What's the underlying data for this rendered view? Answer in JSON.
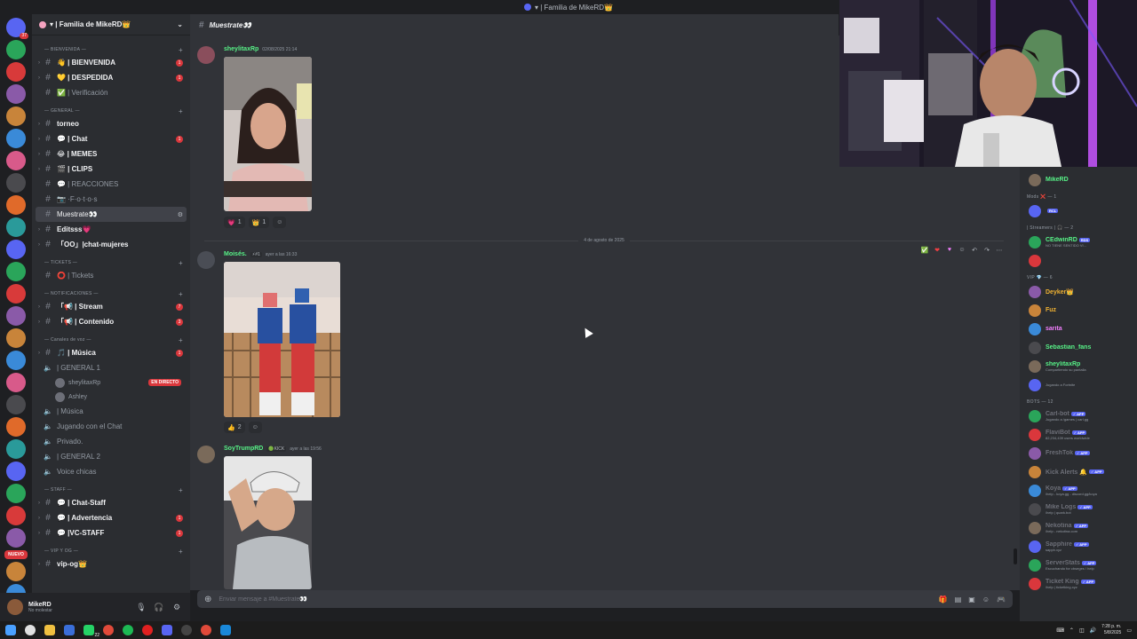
{
  "window": {
    "title": "▾ | Familia de MikeRD👑"
  },
  "server": {
    "name": "▾ | Familia de MikeRD👑"
  },
  "rail": {
    "badges": [
      "37",
      "",
      "",
      "",
      "",
      "",
      "",
      "",
      "",
      "",
      "",
      "",
      "",
      "",
      "",
      "",
      "",
      "",
      "",
      "",
      "",
      "",
      "",
      "",
      "",
      "",
      "",
      ""
    ],
    "nuevo": "NUEVO"
  },
  "categories": {
    "bienvenida": "BIENVENIDA",
    "general": "GENERAL",
    "tickets": "TICKETS",
    "notificaciones": "NOTIFICACIONES",
    "voz": "Canales de voz",
    "staff": "STAFF",
    "vip": "VIP Y OG"
  },
  "channels": [
    {
      "label": "👋 | BIENVENIDA",
      "bold": true,
      "count": "1"
    },
    {
      "label": "💛 | DESPEDIDA",
      "bold": true,
      "count": "1"
    },
    {
      "label": "✅ | Verificación",
      "bold": false,
      "count": ""
    },
    {
      "label": "torneo",
      "bold": true,
      "count": ""
    },
    {
      "label": "💬 | Chat",
      "bold": true,
      "count": "1"
    },
    {
      "label": "😂 | MEMES",
      "bold": true,
      "count": ""
    },
    {
      "label": "🎬 | CLIPS",
      "bold": true,
      "count": ""
    },
    {
      "label": "💬 | REACCIONES",
      "bold": false,
      "count": ""
    },
    {
      "label": "📷 ·F·o·t·o·s",
      "bold": false,
      "count": ""
    },
    {
      "label": "Muestrate👀",
      "bold": false,
      "count": "",
      "active": true
    },
    {
      "label": "Editsss💗",
      "bold": true,
      "count": ""
    },
    {
      "label": "「OO」|chat-mujeres",
      "bold": true,
      "count": ""
    },
    {
      "label": "⭕ | Tickets",
      "bold": false,
      "count": ""
    },
    {
      "label": "「📢 | Stream",
      "bold": true,
      "count": "7"
    },
    {
      "label": "「📢 | Contenido",
      "bold": true,
      "count": "3"
    },
    {
      "label": "🎵 | Música",
      "bold": true,
      "count": "1"
    },
    {
      "label": "| GENERAL 1",
      "bold": false,
      "count": ""
    },
    {
      "label": "| Música",
      "bold": false,
      "count": ""
    },
    {
      "label": "Jugando con el Chat",
      "bold": false,
      "count": ""
    },
    {
      "label": "Privado.",
      "bold": false,
      "count": ""
    },
    {
      "label": "| GENERAL 2",
      "bold": false,
      "count": ""
    },
    {
      "label": "Voice chicas",
      "bold": false,
      "count": ""
    },
    {
      "label": "💬 | Chat-Staff",
      "bold": true,
      "count": ""
    },
    {
      "label": "💬 | Advertencia",
      "bold": true,
      "count": "1"
    },
    {
      "label": "💬 |VC-STAFF",
      "bold": true,
      "count": "1"
    },
    {
      "label": "vip-og👑",
      "bold": true,
      "count": ""
    }
  ],
  "voice_users": [
    {
      "name": "sheylitaxRp",
      "live": "EN DIRECTO"
    },
    {
      "name": "Ashley",
      "live": ""
    }
  ],
  "user_panel": {
    "name": "MikeRD",
    "status": "No molestar"
  },
  "chat": {
    "channel": "Muestrate👀",
    "date_divider": "4 de agosto de 2025",
    "composer_placeholder": "Enviar mensaje a #Muestrate👀",
    "messages": [
      {
        "user": "sheylitaxRp",
        "color": "#57f287",
        "time": "02/08/2025 21:14",
        "tag": "",
        "reactions": [
          {
            "emoji": "💗",
            "count": "1"
          },
          {
            "emoji": "👑",
            "count": "1"
          }
        ]
      },
      {
        "user": "Moisés.",
        "color": "#57f287",
        "time": "ayer a las 16:33",
        "tag": "⚡#1",
        "reactions": [
          {
            "emoji": "👍",
            "count": "2"
          }
        ]
      },
      {
        "user": "SoyTrumpRD",
        "color": "#57f287",
        "time": "ayer a las 19:56",
        "tag": "🟢KICK",
        "reactions": []
      }
    ]
  },
  "members": {
    "owner": {
      "name": "MikeRD",
      "color": "#57f287"
    },
    "groups": [
      {
        "title": "Mods ❌ — 1",
        "items": [
          {
            "name": "",
            "color": "#5865f2",
            "status": "",
            "tag": "RCL"
          }
        ]
      },
      {
        "title": "| Streamers | 🎧 — 2",
        "items": [
          {
            "name": "CEdwinRD",
            "color": "#57f287",
            "status": "NO TIENE SENTIDO VI...",
            "tag": "RDS"
          },
          {
            "name": "",
            "color": "#57f287",
            "status": "",
            "tag": ""
          }
        ]
      },
      {
        "title": "VIP 💎 — 6",
        "items": [
          {
            "name": "Deyker👑",
            "color": "#f0b232",
            "status": "",
            "tag": ""
          },
          {
            "name": "Fuz",
            "color": "#f0b232",
            "status": "",
            "tag": ""
          },
          {
            "name": "sarita",
            "color": "#f47fff",
            "status": "",
            "tag": ""
          },
          {
            "name": "Sebastian_fans",
            "color": "#57f287",
            "status": "",
            "tag": ""
          },
          {
            "name": "sheylitaxRp",
            "color": "#57f287",
            "status": "Compartiendo su pantalla",
            "tag": ""
          },
          {
            "name": "",
            "color": "#da373c",
            "status": "Jugando a Fortnite",
            "tag": ""
          }
        ]
      },
      {
        "title": "BOTS — 12",
        "items": [
          {
            "name": "Carl-bot",
            "color": "#6d6f78",
            "status": "Jugando a /games | carl.gg",
            "tag": "APP"
          },
          {
            "name": "FlaviBot",
            "color": "#6d6f78",
            "status": "82,234,439 users worldwide",
            "tag": "APP"
          },
          {
            "name": "FreshTok",
            "color": "#6d6f78",
            "status": "",
            "tag": "APP"
          },
          {
            "name": "Kick Alerts 🔔",
            "color": "#6d6f78",
            "status": "",
            "tag": "APP"
          },
          {
            "name": "Koya",
            "color": "#6d6f78",
            "status": "/help - koya.gg - discord.gg/koya",
            "tag": "APP"
          },
          {
            "name": "Mike Logs",
            "color": "#6d6f78",
            "status": "/help | quark.bot",
            "tag": "APP"
          },
          {
            "name": "Nekotina",
            "color": "#6d6f78",
            "status": "/help - nekotina.com",
            "tag": "APP"
          },
          {
            "name": "Sapphire",
            "color": "#6d6f78",
            "status": "sapph.xyz",
            "tag": "APP"
          },
          {
            "name": "ServerStats",
            "color": "#6d6f78",
            "status": "Escuchando for cbseges / help",
            "tag": "APP"
          },
          {
            "name": "Ticket King",
            "color": "#6d6f78",
            "status": "/help | ticketking.xyz",
            "tag": "APP"
          }
        ]
      }
    ]
  },
  "taskbar": {
    "time": "7:28 p. m.",
    "date": "5/8/2025",
    "badge": "22"
  },
  "colors": {
    "accent": "#5865f2",
    "online": "#57f287",
    "danger": "#da373c"
  }
}
